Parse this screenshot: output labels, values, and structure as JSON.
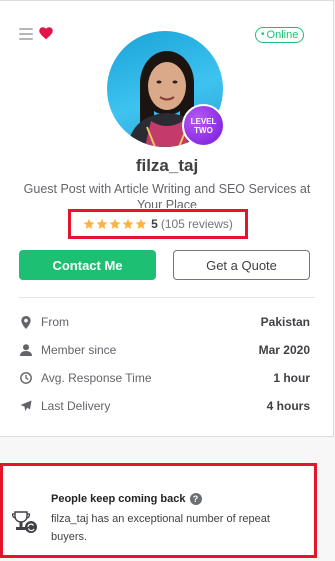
{
  "header": {
    "menu_icon": "hamburger-icon",
    "favorite_icon": "heart-icon",
    "status": "Online"
  },
  "profile": {
    "level_line1": "LEVEL",
    "level_line2": "TWO",
    "username": "filza_taj",
    "tagline": "Guest Post with Article Writing and SEO Services at Your Place",
    "rating": {
      "stars": 5,
      "score": "5",
      "reviews": "(105 reviews)"
    }
  },
  "actions": {
    "contact_label": "Contact Me",
    "quote_label": "Get a Quote"
  },
  "info": [
    {
      "icon": "location-pin-icon",
      "label": "From",
      "value": "Pakistan"
    },
    {
      "icon": "user-icon",
      "label": "Member since",
      "value": "Mar 2020"
    },
    {
      "icon": "clock-icon",
      "label": "Avg. Response Time",
      "value": "1 hour"
    },
    {
      "icon": "paper-plane-icon",
      "label": "Last Delivery",
      "value": "4 hours"
    }
  ],
  "repeat_buyers": {
    "title": "People keep coming back",
    "description": "filza_taj has an exceptional number of repeat buyers."
  },
  "colors": {
    "accent_green": "#1dbf73",
    "highlight_red": "#e5142c",
    "level_purple": "#8a2be2",
    "heart_red": "#e0134a"
  }
}
